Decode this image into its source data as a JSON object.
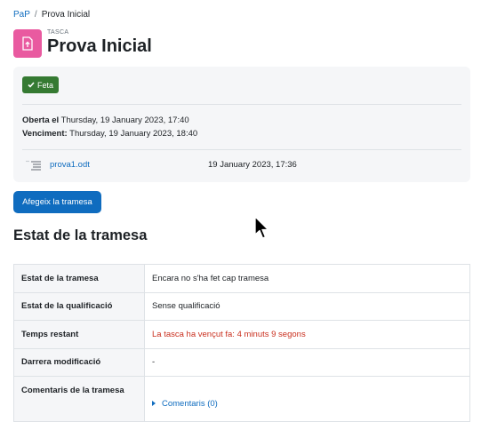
{
  "breadcrumb": {
    "parent": "PaP",
    "separator": "/",
    "current": "Prova Inicial"
  },
  "header": {
    "kicker": "TASCA",
    "title": "Prova Inicial",
    "icon": "assignment-upload-icon",
    "icon_color": "#e95aa0"
  },
  "completion": {
    "label": "Feta",
    "color": "#357a32"
  },
  "dates": {
    "opened_label": "Oberta el",
    "opened_value": "Thursday, 19 January 2023, 17:40",
    "due_label": "Venciment:",
    "due_value": "Thursday, 19 January 2023, 18:40"
  },
  "file": {
    "name": "prova1.odt",
    "date": "19 January 2023, 17:36",
    "icon": "document-icon"
  },
  "actions": {
    "submit_label": "Afegeix la tramesa"
  },
  "status": {
    "heading": "Estat de la tramesa",
    "rows": [
      {
        "label": "Estat de la tramesa",
        "value": "Encara no s'ha fet cap tramesa"
      },
      {
        "label": "Estat de la qualificació",
        "value": "Sense qualificació"
      },
      {
        "label": "Temps restant",
        "value": "La tasca ha vençut fa: 4 minuts 9 segons"
      },
      {
        "label": "Darrera modificació",
        "value": "-"
      },
      {
        "label": "Comentaris de la tramesa",
        "value": "Comentaris (0)"
      }
    ]
  },
  "colors": {
    "link": "#0f6cbf",
    "overdue": "#ca3120",
    "primary": "#0f6cbf"
  }
}
